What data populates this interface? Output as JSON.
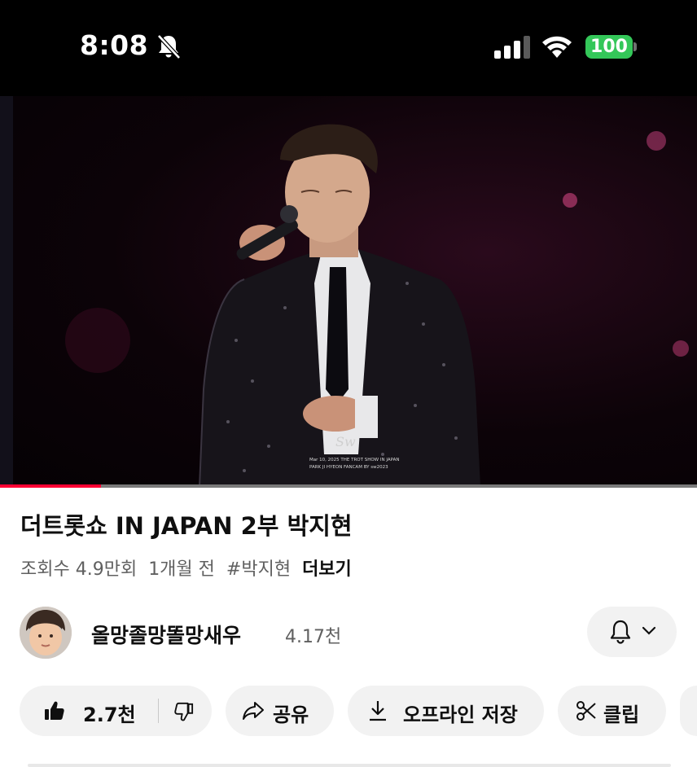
{
  "status": {
    "time": "8:08",
    "battery": "100",
    "icons": [
      "bell-off-icon",
      "cellular-signal-icon",
      "wifi-icon",
      "battery-icon"
    ]
  },
  "video": {
    "watermark": "Sw",
    "caption_line1": "Mar 10, 2025 THE TROT SHOW IN JAPAN",
    "caption_line2": "PARK JI HYEON FANCAM BY sw2023",
    "progress_fraction": 0.145
  },
  "info": {
    "title": "더트롯쇼 IN JAPAN 2부 박지현",
    "views": "조회수 4.9만회",
    "age": "1개월 전",
    "hashtag": "#박지현",
    "more_label": "더보기"
  },
  "channel": {
    "name": "올망졸망똘망새우",
    "subscribers": "4.17천"
  },
  "actions": {
    "like_count": "2.7천",
    "share_label": "공유",
    "download_label": "오프라인 저장",
    "clip_label": "클립"
  },
  "colors": {
    "progress": "#ff0033",
    "battery": "#34c759",
    "chip_bg": "#f2f2f2"
  }
}
